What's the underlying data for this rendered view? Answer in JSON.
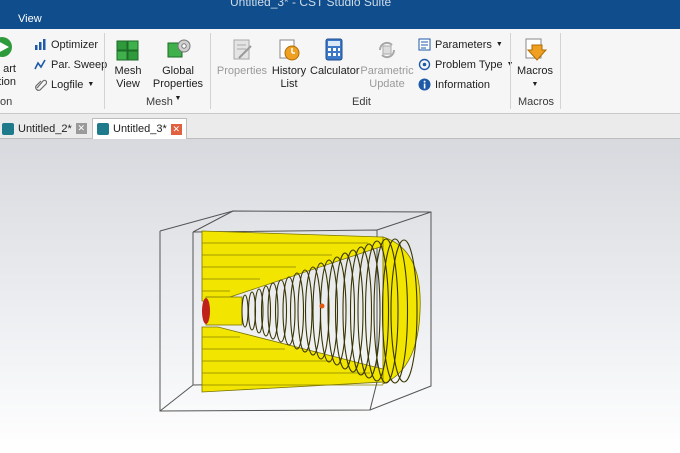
{
  "window": {
    "title": "Untitled_3* - CST Studio Suite"
  },
  "menu": {
    "view": "View"
  },
  "ribbon": {
    "start": {
      "line1": "art",
      "line2": "ation"
    },
    "simulation_group_label": "on",
    "optimizer": "Optimizer",
    "par_sweep": "Par. Sweep",
    "logfile": "Logfile",
    "mesh_view": {
      "line1": "Mesh",
      "line2": "View"
    },
    "global_properties": {
      "line1": "Global",
      "line2": "Properties"
    },
    "mesh_group_label": "Mesh",
    "properties": "Properties",
    "history_list": {
      "line1": "History",
      "line2": "List"
    },
    "calculator": "Calculator",
    "parametric_update": {
      "line1": "Parametric",
      "line2": "Update"
    },
    "parameters": "Parameters",
    "problem_type": "Problem Type",
    "information": "Information",
    "edit_group_label": "Edit",
    "macros": "Macros",
    "macros_group_label": "Macros"
  },
  "tabs": [
    {
      "label": "Untitled_2*",
      "active": false
    },
    {
      "label": "Untitled_3*",
      "active": true
    }
  ],
  "colors": {
    "titlebar": "#0f4d8c",
    "horn": "#f2e600",
    "accent_red": "#c0201a"
  },
  "icons": [
    "play-icon",
    "optimizer-icon",
    "par-sweep-icon",
    "logfile-icon",
    "mesh-view-icon",
    "global-properties-icon",
    "properties-icon",
    "history-list-icon",
    "calculator-icon",
    "parametric-update-icon",
    "parameters-icon",
    "problem-type-icon",
    "information-icon",
    "macros-icon"
  ]
}
